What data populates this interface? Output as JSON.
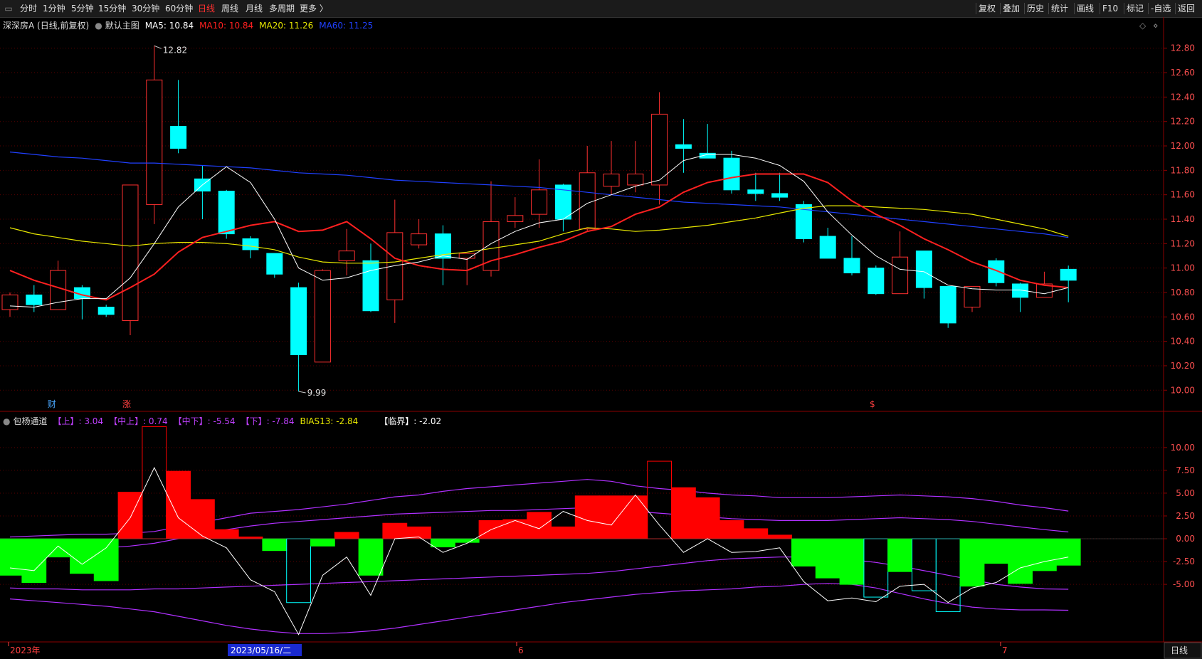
{
  "toolbar": {
    "left_items": [
      "分时",
      "1分钟",
      "5分钟",
      "15分钟",
      "30分钟",
      "60分钟",
      "日线",
      "周线",
      "月线",
      "多周期",
      "更多 〉"
    ],
    "active_index": 6,
    "right_items": [
      "复权",
      "叠加",
      "历史",
      "统计",
      "画线",
      "F10",
      "标记",
      "-自选",
      "返回"
    ]
  },
  "main": {
    "stock_title": "深深房A (日线,前复权)",
    "template_label": "默认主图",
    "ma_legend": [
      {
        "text": "MA5: 10.84",
        "color": "#ffffff"
      },
      {
        "text": "MA10: 10.84",
        "color": "#ff2020"
      },
      {
        "text": "MA20: 11.26",
        "color": "#e8e800"
      },
      {
        "text": "MA60: 11.25",
        "color": "#2040ff"
      }
    ],
    "high_label": "12.82",
    "low_label": "9.99",
    "price_ticks": [
      "12.80",
      "12.60",
      "12.40",
      "12.20",
      "12.00",
      "11.80",
      "11.60",
      "11.40",
      "11.20",
      "11.00",
      "10.80",
      "10.60",
      "10.40",
      "10.20",
      "10.00"
    ],
    "event_marks": [
      "财",
      "涨",
      "$"
    ]
  },
  "indicator": {
    "name": "包杨通道",
    "legend": [
      {
        "text": "【上】: 3.04",
        "color": "#c040ff"
      },
      {
        "text": "【中上】: 0.74",
        "color": "#c040ff"
      },
      {
        "text": "【中下】: -5.54",
        "color": "#c040ff"
      },
      {
        "text": "【下】: -7.84",
        "color": "#c040ff"
      },
      {
        "text": "BIAS13: -2.84",
        "color": "#e8e800"
      },
      {
        "text": "【临界】: -2.02",
        "color": "#ffffff"
      }
    ],
    "ticks": [
      "10.00",
      "7.50",
      "5.00",
      "2.50",
      "0.00",
      "-2.50",
      "-5.00"
    ]
  },
  "bottom": {
    "date_left": "2023年",
    "date_selected": "2023/05/16/二",
    "month_6": "6",
    "month_7": "7",
    "period": "日线"
  },
  "colors": {
    "up": "#ff3030",
    "down": "#00ffff",
    "grid": "#5a0000",
    "ma5": "#ffffff",
    "ma10": "#ff2020",
    "ma20": "#e8e800",
    "ma60": "#2040ff",
    "channel": "#b030ff",
    "bar_up": "#ff0000",
    "bar_down": "#00ff00"
  },
  "chart_data": {
    "type": "candlestick",
    "candles": [
      {
        "o": 10.66,
        "h": 10.8,
        "l": 10.6,
        "c": 10.78
      },
      {
        "o": 10.78,
        "h": 10.86,
        "l": 10.64,
        "c": 10.7
      },
      {
        "o": 10.66,
        "h": 11.06,
        "l": 10.66,
        "c": 10.98
      },
      {
        "o": 10.84,
        "h": 10.86,
        "l": 10.58,
        "c": 10.75
      },
      {
        "o": 10.68,
        "h": 10.7,
        "l": 10.6,
        "c": 10.62
      },
      {
        "o": 10.57,
        "h": 11.68,
        "l": 10.45,
        "c": 11.68
      },
      {
        "o": 11.52,
        "h": 12.82,
        "l": 11.36,
        "c": 12.54
      },
      {
        "o": 12.16,
        "h": 12.54,
        "l": 11.94,
        "c": 11.98
      },
      {
        "o": 11.73,
        "h": 11.84,
        "l": 11.4,
        "c": 11.63
      },
      {
        "o": 11.63,
        "h": 11.64,
        "l": 11.24,
        "c": 11.28
      },
      {
        "o": 11.24,
        "h": 11.26,
        "l": 11.08,
        "c": 11.15
      },
      {
        "o": 11.12,
        "h": 11.12,
        "l": 10.92,
        "c": 10.95
      },
      {
        "o": 10.84,
        "h": 10.88,
        "l": 9.99,
        "c": 10.29
      },
      {
        "o": 10.23,
        "h": 10.99,
        "l": 10.23,
        "c": 10.98
      },
      {
        "o": 11.06,
        "h": 11.32,
        "l": 10.94,
        "c": 11.14
      },
      {
        "o": 11.06,
        "h": 11.2,
        "l": 10.64,
        "c": 10.65
      },
      {
        "o": 10.74,
        "h": 11.56,
        "l": 10.55,
        "c": 11.29
      },
      {
        "o": 11.19,
        "h": 11.4,
        "l": 11.16,
        "c": 11.28
      },
      {
        "o": 11.28,
        "h": 11.35,
        "l": 10.86,
        "c": 11.08
      },
      {
        "o": 11.08,
        "h": 11.12,
        "l": 10.86,
        "c": 11.12
      },
      {
        "o": 10.98,
        "h": 11.71,
        "l": 10.93,
        "c": 11.38
      },
      {
        "o": 11.38,
        "h": 11.58,
        "l": 11.33,
        "c": 11.43
      },
      {
        "o": 11.44,
        "h": 11.89,
        "l": 11.33,
        "c": 11.64
      },
      {
        "o": 11.68,
        "h": 11.69,
        "l": 11.3,
        "c": 11.4
      },
      {
        "o": 11.32,
        "h": 12.0,
        "l": 11.3,
        "c": 11.78
      },
      {
        "o": 11.67,
        "h": 12.04,
        "l": 11.6,
        "c": 11.77
      },
      {
        "o": 11.68,
        "h": 12.04,
        "l": 11.62,
        "c": 11.77
      },
      {
        "o": 11.68,
        "h": 12.44,
        "l": 11.52,
        "c": 12.26
      },
      {
        "o": 12.01,
        "h": 12.22,
        "l": 11.78,
        "c": 11.98
      },
      {
        "o": 11.94,
        "h": 12.18,
        "l": 11.9,
        "c": 11.9
      },
      {
        "o": 11.9,
        "h": 11.96,
        "l": 11.61,
        "c": 11.64
      },
      {
        "o": 11.64,
        "h": 11.78,
        "l": 11.55,
        "c": 11.61
      },
      {
        "o": 11.61,
        "h": 11.78,
        "l": 11.55,
        "c": 11.58
      },
      {
        "o": 11.52,
        "h": 11.55,
        "l": 11.21,
        "c": 11.24
      },
      {
        "o": 11.26,
        "h": 11.33,
        "l": 11.08,
        "c": 11.08
      },
      {
        "o": 11.08,
        "h": 11.26,
        "l": 10.94,
        "c": 10.96
      },
      {
        "o": 11.0,
        "h": 11.02,
        "l": 10.78,
        "c": 10.79
      },
      {
        "o": 10.79,
        "h": 11.3,
        "l": 10.79,
        "c": 11.09
      },
      {
        "o": 11.14,
        "h": 11.14,
        "l": 10.75,
        "c": 10.84
      },
      {
        "o": 10.85,
        "h": 10.85,
        "l": 10.51,
        "c": 10.55
      },
      {
        "o": 10.68,
        "h": 10.85,
        "l": 10.64,
        "c": 10.85
      },
      {
        "o": 11.06,
        "h": 11.08,
        "l": 10.85,
        "c": 10.88
      },
      {
        "o": 10.87,
        "h": 10.88,
        "l": 10.64,
        "c": 10.76
      },
      {
        "o": 10.76,
        "h": 10.97,
        "l": 10.76,
        "c": 10.87
      },
      {
        "o": 10.99,
        "h": 11.02,
        "l": 10.72,
        "c": 10.9
      }
    ],
    "ma5": [
      10.69,
      10.68,
      10.72,
      10.75,
      10.75,
      10.92,
      11.2,
      11.5,
      11.68,
      11.83,
      11.7,
      11.4,
      11.0,
      10.9,
      10.92,
      10.98,
      11.02,
      11.05,
      11.1,
      11.07,
      11.2,
      11.3,
      11.37,
      11.4,
      11.53,
      11.6,
      11.67,
      11.72,
      11.88,
      11.93,
      11.93,
      11.9,
      11.84,
      11.71,
      11.46,
      11.27,
      11.1,
      10.99,
      10.97,
      10.86,
      10.83,
      10.82,
      10.82,
      10.79,
      10.84
    ],
    "ma10": [
      10.98,
      10.9,
      10.84,
      10.78,
      10.74,
      10.84,
      10.95,
      11.13,
      11.25,
      11.3,
      11.35,
      11.38,
      11.3,
      11.31,
      11.38,
      11.24,
      11.08,
      11.02,
      10.99,
      10.98,
      11.06,
      11.11,
      11.17,
      11.22,
      11.3,
      11.34,
      11.44,
      11.5,
      11.62,
      11.7,
      11.74,
      11.77,
      11.77,
      11.77,
      11.7,
      11.55,
      11.44,
      11.35,
      11.24,
      11.15,
      11.05,
      10.98,
      10.9,
      10.86,
      10.84
    ],
    "ma20": [
      11.33,
      11.28,
      11.25,
      11.22,
      11.2,
      11.18,
      11.2,
      11.21,
      11.21,
      11.2,
      11.18,
      11.15,
      11.09,
      11.05,
      11.04,
      11.04,
      11.05,
      11.08,
      11.11,
      11.13,
      11.16,
      11.19,
      11.22,
      11.28,
      11.33,
      11.32,
      11.3,
      11.31,
      11.33,
      11.35,
      11.38,
      11.41,
      11.45,
      11.49,
      11.51,
      11.51,
      11.5,
      11.49,
      11.48,
      11.46,
      11.44,
      11.4,
      11.36,
      11.32,
      11.26
    ],
    "ma60": [
      11.95,
      11.93,
      11.91,
      11.9,
      11.88,
      11.86,
      11.86,
      11.85,
      11.84,
      11.83,
      11.82,
      11.8,
      11.78,
      11.77,
      11.76,
      11.74,
      11.72,
      11.71,
      11.7,
      11.69,
      11.68,
      11.67,
      11.66,
      11.64,
      11.62,
      11.6,
      11.58,
      11.56,
      11.54,
      11.53,
      11.52,
      11.51,
      11.5,
      11.48,
      11.46,
      11.44,
      11.42,
      11.4,
      11.38,
      11.36,
      11.34,
      11.32,
      11.3,
      11.28,
      11.25
    ],
    "bias_bars": [
      -4.0,
      -4.8,
      -2.0,
      -3.8,
      -4.6,
      5.1,
      12.3,
      7.4,
      4.3,
      1.0,
      0.2,
      -1.3,
      -7.0,
      -0.8,
      0.7,
      -4.0,
      1.7,
      1.3,
      -0.9,
      -0.4,
      2.0,
      2.1,
      2.9,
      1.3,
      4.7,
      4.7,
      4.7,
      8.5,
      5.6,
      4.5,
      2.0,
      1.1,
      0.4,
      -3.0,
      -4.3,
      -5.0,
      -6.4,
      -3.6,
      -5.7,
      -8.0,
      -5.2,
      -2.7,
      -4.9,
      -3.5,
      -2.9
    ],
    "critical": [
      -3.2,
      -3.5,
      -0.8,
      -2.8,
      -1.0,
      2.3,
      7.8,
      2.3,
      0.3,
      -1.0,
      -4.5,
      -5.8,
      -10.5,
      -4.0,
      -2.0,
      -6.2,
      0.0,
      0.2,
      -1.5,
      -0.5,
      1.0,
      2.0,
      1.1,
      3.0,
      2.0,
      1.5,
      4.8,
      1.5,
      -1.5,
      0.0,
      -1.5,
      -1.4,
      -1.0,
      -4.7,
      -6.8,
      -6.5,
      -6.9,
      -5.2,
      -5.0,
      -7.0,
      -5.4,
      -4.8,
      -3.2,
      -2.5,
      -2.0
    ],
    "upper": [
      0.2,
      0.3,
      0.4,
      0.5,
      0.5,
      0.6,
      0.8,
      1.3,
      1.8,
      2.3,
      2.8,
      3.0,
      3.2,
      3.5,
      3.8,
      4.2,
      4.6,
      4.8,
      5.2,
      5.5,
      5.7,
      5.9,
      6.1,
      6.3,
      6.5,
      6.3,
      5.8,
      5.5,
      5.3,
      5.0,
      4.8,
      4.7,
      4.5,
      4.5,
      4.5,
      4.6,
      4.7,
      4.8,
      4.7,
      4.6,
      4.4,
      4.1,
      3.7,
      3.4,
      3.04
    ],
    "mid_upper": [
      -1.8,
      -1.6,
      -1.4,
      -1.2,
      -1.0,
      -0.8,
      -0.5,
      0.0,
      0.5,
      1.0,
      1.4,
      1.7,
      1.9,
      2.1,
      2.3,
      2.5,
      2.7,
      2.8,
      2.9,
      3.0,
      3.1,
      3.1,
      3.2,
      3.3,
      3.4,
      3.3,
      3.0,
      2.8,
      2.6,
      2.4,
      2.2,
      2.1,
      2.0,
      2.0,
      2.0,
      2.1,
      2.2,
      2.3,
      2.2,
      2.1,
      1.9,
      1.6,
      1.3,
      1.0,
      0.74
    ],
    "mid_lower": [
      -5.4,
      -5.5,
      -5.5,
      -5.6,
      -5.6,
      -5.6,
      -5.5,
      -5.5,
      -5.4,
      -5.3,
      -5.2,
      -5.1,
      -5.0,
      -4.9,
      -4.8,
      -4.7,
      -4.6,
      -4.5,
      -4.4,
      -4.3,
      -4.2,
      -4.1,
      -4.0,
      -3.9,
      -3.8,
      -3.6,
      -3.3,
      -3.0,
      -2.7,
      -2.4,
      -2.2,
      -2.1,
      -2.0,
      -2.0,
      -2.1,
      -2.3,
      -2.6,
      -3.0,
      -3.5,
      -4.0,
      -4.5,
      -5.0,
      -5.3,
      -5.5,
      -5.54
    ],
    "lower": [
      -6.6,
      -6.8,
      -7.0,
      -7.2,
      -7.4,
      -7.7,
      -8.0,
      -8.5,
      -9.0,
      -9.5,
      -9.9,
      -10.2,
      -10.4,
      -10.4,
      -10.3,
      -10.1,
      -9.8,
      -9.4,
      -9.0,
      -8.6,
      -8.2,
      -7.8,
      -7.4,
      -7.0,
      -6.7,
      -6.4,
      -6.1,
      -5.9,
      -5.7,
      -5.6,
      -5.5,
      -5.3,
      -5.2,
      -5.0,
      -4.9,
      -5.0,
      -5.4,
      -6.0,
      -6.6,
      -7.1,
      -7.5,
      -7.7,
      -7.8,
      -7.8,
      -7.84
    ],
    "price_range": [
      9.92,
      12.88
    ],
    "indicator_range": [
      -11.0,
      13.5
    ]
  }
}
